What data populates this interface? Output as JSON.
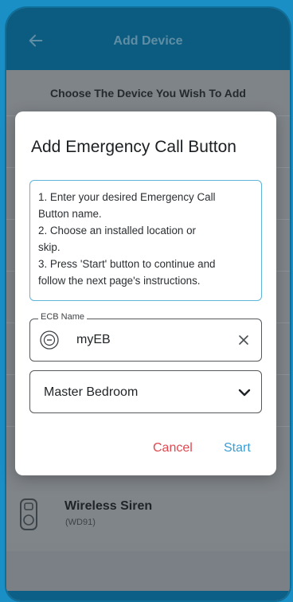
{
  "header": {
    "title": "Add Device",
    "back_icon": "arrow-left-icon"
  },
  "page": {
    "section_title": "Choose The Device You Wish To Add"
  },
  "device_list": [
    {
      "name": "Wireless Siren",
      "model": "(WD91)",
      "icon": "siren-device-icon"
    }
  ],
  "modal": {
    "title": "Add Emergency Call Button",
    "instructions": [
      "1. Enter your desired Emergency Call",
      "Button name.",
      "2. Choose an installed location or",
      "skip.",
      "3. Press 'Start' button to continue and",
      "follow the next page's instructions."
    ],
    "name_field": {
      "legend": "ECB Name",
      "value": "myEB",
      "icon": "ecb-button-icon",
      "clear_icon": "close-icon"
    },
    "location_select": {
      "value": "Master Bedroom",
      "icon": "chevron-down-icon"
    },
    "buttons": {
      "cancel": "Cancel",
      "start": "Start"
    }
  },
  "colors": {
    "header_bg": "#0b5c80",
    "accent_blue": "#3a9fd4",
    "cancel_red": "#e0474f",
    "field_border_focus": "#5fb4da"
  }
}
